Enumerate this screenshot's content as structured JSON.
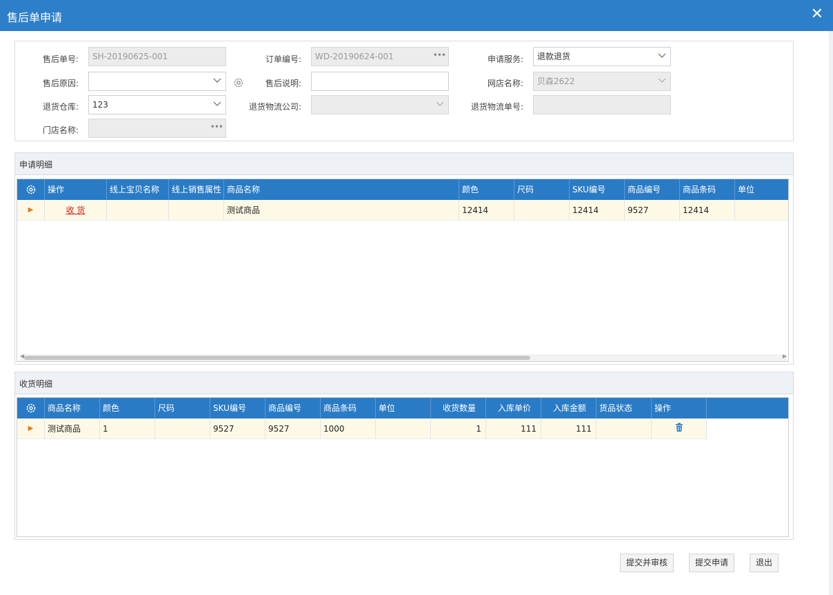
{
  "window": {
    "title": "售后单申请",
    "close_icon": "close-icon"
  },
  "form": {
    "after_sale_no": {
      "label": "售后单号:",
      "value": "SH-20190625-001"
    },
    "order_no": {
      "label": "订单编号:",
      "value": "WD-20190624-001"
    },
    "service": {
      "label": "申请服务:",
      "value": "退款退货"
    },
    "reason": {
      "label": "售后原因:",
      "value": ""
    },
    "note": {
      "label": "售后说明:",
      "value": ""
    },
    "shop": {
      "label": "网店名称:",
      "value": "贝森2622"
    },
    "warehouse": {
      "label": "退货仓库:",
      "value": "123"
    },
    "logistics_company": {
      "label": "退货物流公司:",
      "value": ""
    },
    "logistics_no": {
      "label": "退货物流单号:",
      "value": ""
    },
    "store": {
      "label": "门店名称:",
      "value": ""
    }
  },
  "apply_detail": {
    "title": "申请明细",
    "columns": [
      "操作",
      "线上宝贝名称",
      "线上销售属性",
      "商品名称",
      "颜色",
      "尺码",
      "SKU编号",
      "商品编号",
      "商品条码",
      "单位"
    ],
    "rows": [
      {
        "action": "收 货",
        "online_name": "",
        "online_attr": "",
        "product_name": "测试商品",
        "color": "12414",
        "size": "",
        "sku": "12414",
        "product_no": "9527",
        "barcode": "12414",
        "unit": ""
      }
    ]
  },
  "receive_detail": {
    "title": "收货明细",
    "columns": [
      "商品名称",
      "颜色",
      "尺码",
      "SKU编号",
      "商品编号",
      "商品条码",
      "单位",
      "收货数量",
      "入库单价",
      "入库金额",
      "货品状态",
      "操作"
    ],
    "rows": [
      {
        "product_name": "测试商品",
        "color": "1",
        "size": "",
        "sku": "9527",
        "product_no": "9527",
        "barcode": "1000",
        "unit": "",
        "qty": "1",
        "unit_price": "111",
        "amount": "111",
        "status": ""
      }
    ]
  },
  "buttons": {
    "submit_audit": "提交并审核",
    "submit": "提交申请",
    "exit": "退出"
  },
  "colors": {
    "title_bar": "#2e7fc9",
    "grid_header": "#2a7bc6",
    "row_highlight": "#fef9e7",
    "link_red": "#d0201a"
  }
}
